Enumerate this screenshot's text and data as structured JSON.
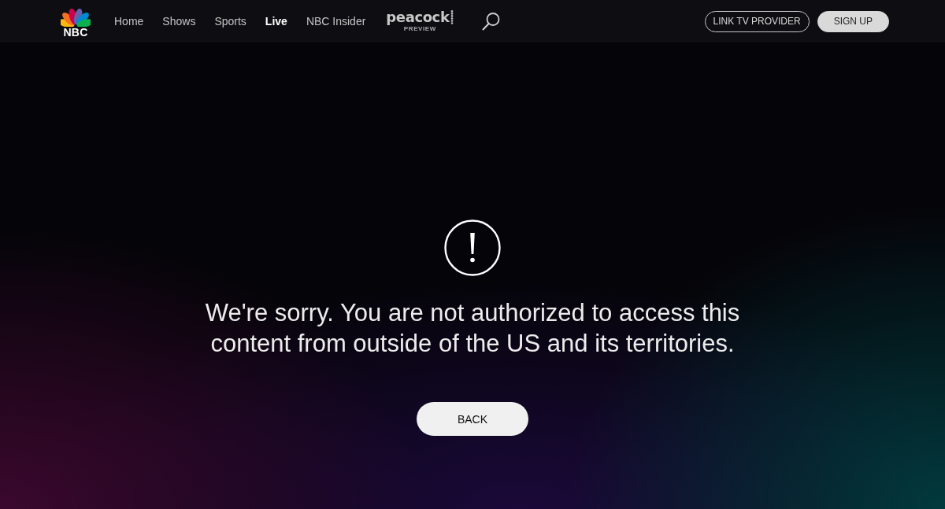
{
  "header": {
    "logo": {
      "text": "NBC"
    },
    "nav": [
      {
        "label": "Home",
        "selected": false
      },
      {
        "label": "Shows",
        "selected": false
      },
      {
        "label": "Sports",
        "selected": false
      },
      {
        "label": "Live",
        "selected": true
      },
      {
        "label": "NBC Insider",
        "selected": false
      }
    ],
    "peacock": {
      "wordmark": "peacock",
      "badge": "PREVIEW"
    },
    "buttons": [
      {
        "label": "LINK TV PROVIDER",
        "kind": "outline"
      },
      {
        "label": "SIGN UP",
        "kind": "filled"
      }
    ]
  },
  "message": {
    "text": "We're sorry. You are not authorized to access this content from outside of the US and its territories.",
    "button": "BACK"
  }
}
